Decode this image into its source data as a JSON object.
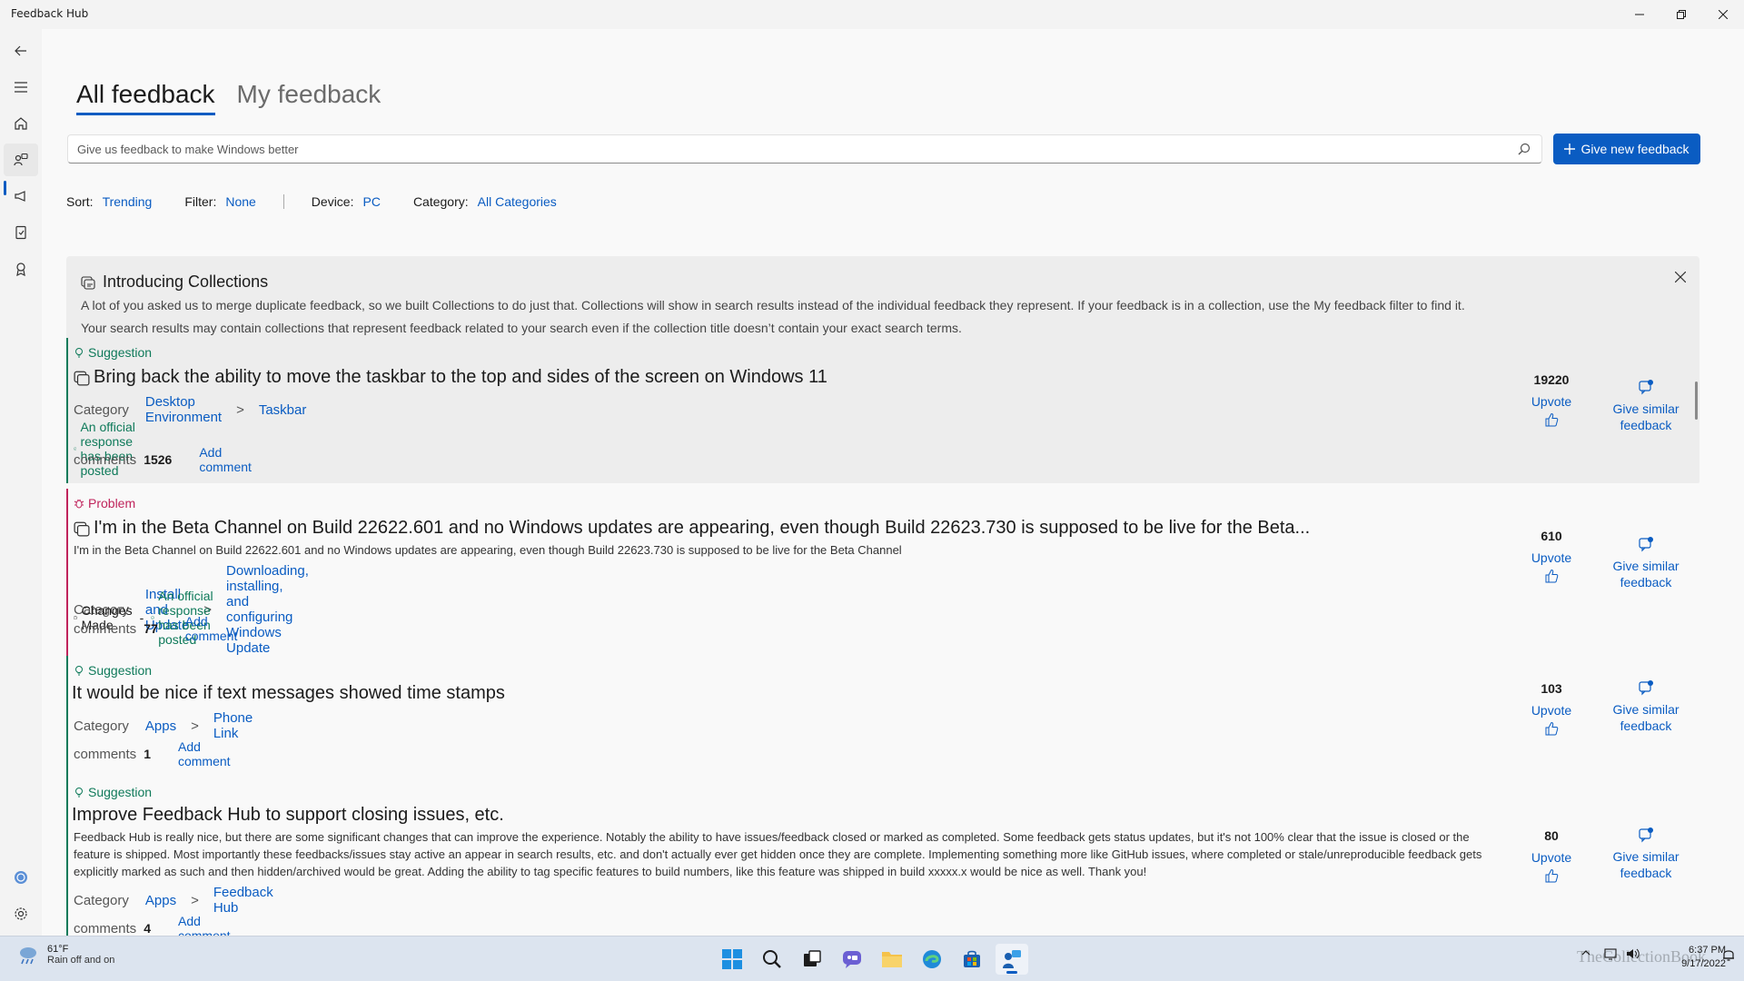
{
  "window": {
    "title": "Feedback Hub"
  },
  "tabs": [
    {
      "label": "All feedback",
      "active": true
    },
    {
      "label": "My feedback",
      "active": false
    }
  ],
  "search": {
    "placeholder": "Give us feedback to make Windows better",
    "value": ""
  },
  "new_feedback_button": "Give new feedback",
  "filters": {
    "sort_label": "Sort:",
    "sort_value": "Trending",
    "filter_label": "Filter:",
    "filter_value": "None",
    "device_label": "Device:",
    "device_value": "PC",
    "category_label": "Category:",
    "category_value": "All Categories"
  },
  "banner": {
    "title": "Introducing Collections",
    "line1": "A lot of you asked us to merge duplicate feedback, so we built Collections to do just that. Collections will show in search results instead of the individual feedback they represent. If your feedback is in a collection, use the My feedback filter to find it.",
    "line2": "Your search results may contain collections that represent feedback related to your search even if the collection title doesn’t contain your exact search terms."
  },
  "common": {
    "category_label": "Category",
    "comments_label": "comments",
    "add_comment": "Add comment",
    "upvote": "Upvote",
    "give_similar_1": "Give similar",
    "give_similar_2": "feedback",
    "official_response": "An official response has been posted",
    "changes_made": "Changes Made",
    "dash": "-",
    "cat_sep": ">"
  },
  "items": [
    {
      "type": "Suggestion",
      "title": "Bring back the ability to move the taskbar to the top and sides of the screen on Windows 11",
      "description": "",
      "category": "Desktop Environment",
      "subcategory": "Taskbar",
      "comments": "1526",
      "upvotes": "19220"
    },
    {
      "type": "Problem",
      "title": "I'm in the Beta Channel on Build 22622.601 and no Windows updates are appearing, even though Build 22623.730 is supposed to be live for the Beta...",
      "description": "I'm in the Beta Channel on Build 22622.601 and no Windows updates are appearing, even though Build 22623.730 is supposed to be live for the Beta Channel",
      "category": "Install and Update",
      "subcategory": "Downloading, installing, and configuring Windows Update",
      "comments": "77",
      "upvotes": "610"
    },
    {
      "type": "Suggestion",
      "title": "It would be nice if text messages showed time stamps",
      "description": "",
      "category": "Apps",
      "subcategory": "Phone Link",
      "comments": "1",
      "upvotes": "103"
    },
    {
      "type": "Suggestion",
      "title": "Improve Feedback Hub to support closing issues, etc.",
      "description": "Feedback Hub is really nice, but there are some significant changes that can improve the experience. Notably the ability to have issues/feedback closed or marked as completed. Some feedback gets status updates, but it's not 100% clear that the issue is closed or the feature is shipped. Most importantly these feedbacks/issues stay active an appear in search results, etc. and don't actually ever get hidden once they are complete. Implementing something more like GitHub issues, where completed or stale/unreproducible feedback gets explicitly marked as such and then hidden/archived would be great. Adding the ability to tag specific features to build numbers, like this feature was shipped in build xxxxx.x would be nice as well. Thank you!",
      "category": "Apps",
      "subcategory": "Feedback Hub",
      "comments": "4",
      "upvotes": "80"
    }
  ],
  "taskbar": {
    "weather_temp": "61°F",
    "weather_cond": "Rain off and on",
    "time": "6:37 PM",
    "date": "9/17/2022",
    "watermark": "TheCollectionBook"
  },
  "colors": {
    "accent": "#0a5cc2",
    "suggestion": "#0f7a5a",
    "problem": "#c0245c"
  }
}
